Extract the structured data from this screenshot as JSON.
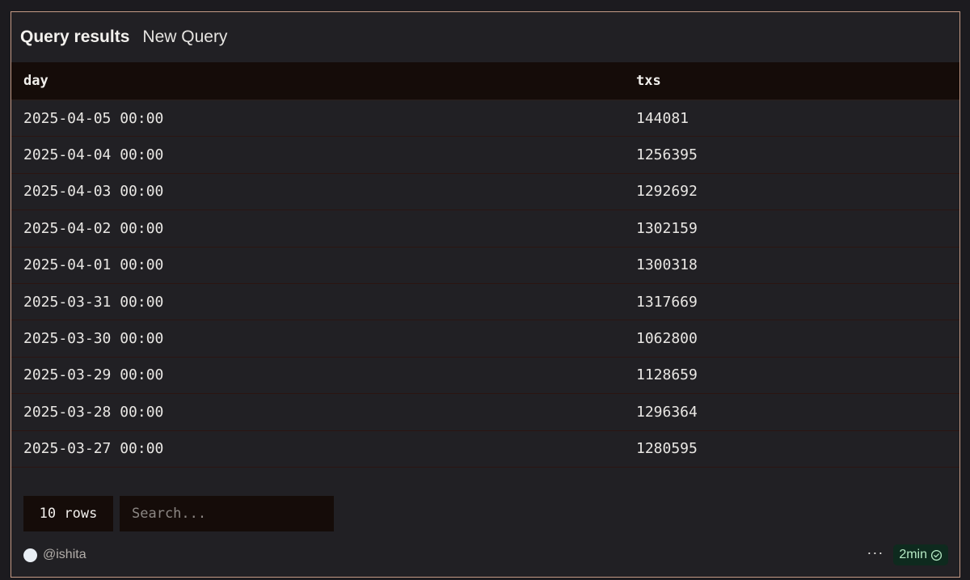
{
  "header": {
    "title": "Query results",
    "query_name": "New Query"
  },
  "table": {
    "columns": [
      "day",
      "txs"
    ],
    "rows": [
      {
        "day": "2025-04-05 00:00",
        "txs": "144081"
      },
      {
        "day": "2025-04-04 00:00",
        "txs": "1256395"
      },
      {
        "day": "2025-04-03 00:00",
        "txs": "1292692"
      },
      {
        "day": "2025-04-02 00:00",
        "txs": "1302159"
      },
      {
        "day": "2025-04-01 00:00",
        "txs": "1300318"
      },
      {
        "day": "2025-03-31 00:00",
        "txs": "1317669"
      },
      {
        "day": "2025-03-30 00:00",
        "txs": "1062800"
      },
      {
        "day": "2025-03-29 00:00",
        "txs": "1128659"
      },
      {
        "day": "2025-03-28 00:00",
        "txs": "1296364"
      },
      {
        "day": "2025-03-27 00:00",
        "txs": "1280595"
      }
    ]
  },
  "footer": {
    "rows_label": "10 rows",
    "search_placeholder": "Search...",
    "author": "@ishita",
    "more_label": "···",
    "time_label": "2min"
  },
  "icons": {
    "avatar": "avatar-circle",
    "more": "more-horizontal-icon",
    "status": "check-circle-icon"
  },
  "colors": {
    "border_accent": "#c59b86",
    "header_bg": "#150c09",
    "badge_bg": "#0e2a1e",
    "badge_text": "#b6e9c4"
  }
}
